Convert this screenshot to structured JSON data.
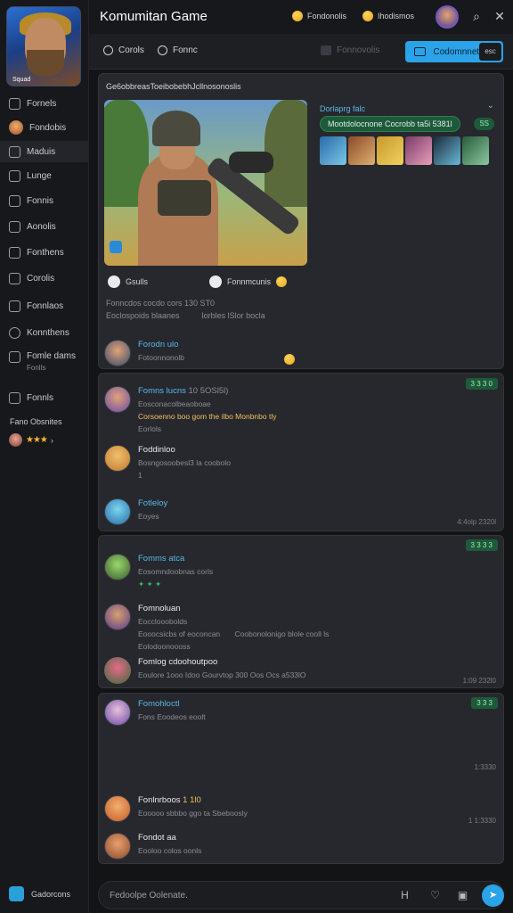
{
  "sidebar": {
    "logo_tag": "Squad",
    "items": [
      {
        "label": "Fornels",
        "icon": "chat-icon"
      },
      {
        "label": "Fondobis",
        "icon": "avatar-icon"
      },
      {
        "label": "Maduis",
        "icon": "gamepad-icon"
      },
      {
        "label": "Lunge",
        "icon": "bell-icon"
      },
      {
        "label": "Fonnis",
        "icon": "pencil-icon"
      },
      {
        "label": "Aonolis",
        "icon": "calendar-icon"
      },
      {
        "label": "Fonthens",
        "icon": "document-icon"
      },
      {
        "label": "Corolis",
        "icon": "document-icon"
      },
      {
        "label": "Fonnlaos",
        "icon": "folder-icon"
      },
      {
        "label": "Konnthens",
        "icon": "clock-icon"
      },
      {
        "label": "Fomle dams",
        "label2": "Fonlls",
        "icon": "list-icon"
      },
      {
        "label": "Fonnls",
        "icon": "users-icon"
      }
    ],
    "favorites_label": "Fano Obsnites",
    "favorites_stars": "★★★",
    "favorites_arrow": "›",
    "bottom_label": "Gadorcons"
  },
  "topbar": {
    "title": "Komumitan Game",
    "link1": "Fondonolis",
    "link2": "Ihodismos",
    "search_icon": "⌕",
    "close_icon": "✕"
  },
  "toolbar": {
    "item1": "Corols",
    "item2": "Fonnc",
    "ghost": "Fonnovolis",
    "cta_label": "Codomnnet",
    "cta_badge": "esc"
  },
  "post": {
    "header": "Ge6obbreasToeibobebhJcllnosonoslis",
    "media_title": "Dorlaprg falc",
    "media_pill": "Mootdolocnone Cocrobb ta5i 5381l",
    "media_count": "SS",
    "chev": "⌄",
    "chip1": "Gsulls",
    "chip2": "Fonnmcunis",
    "line1": "Fonncdos cocdo cors 130 ST0",
    "line2": "Eoclospoids blaanes",
    "line2b": "Iorbles lSlor bocla",
    "author_name": "Forodn ulo",
    "author_sub": "Fotoonnonolb"
  },
  "thread1": {
    "badge": "3 3 3 0",
    "m1_name": "Fomns lucns",
    "m1_meta": "10 5OSl5l)",
    "m1_sub": "Eosconacolbeaoboae",
    "m1_hl": "Corsoenno boo gom the ilbo Monbnbo tly",
    "m1_sub2": "Eorlols",
    "m2_name": "Foddinloo",
    "m2_sub": "Bosngosoobesl3 la coobolo",
    "m2_sub2": "1",
    "m3_name": "Fotleloy",
    "m3_sub": "Eoyes",
    "m3_time": "4:4olp 2320l"
  },
  "thread2": {
    "badge": "3 3 3 3",
    "m1_name": "Fomms atca",
    "m1_sub": "Eosomndoobnas corls",
    "m1_sub2": "✦ ✦ ✦",
    "m2_name": "Fomnoluan",
    "m2_sub": "Eocclooobolds",
    "m2_sub2": "Eooocsicbs of eoconcan",
    "m2_sub3": "Coobonolonigo blole cooll ls",
    "m2_sub4": "Eolodoonoooss",
    "m3_name": "Fomlog cdoohoutpoo",
    "m3_sub": "Eoulore 1ooo Idoo Gourvtop 300 Oos Ocs a533lO",
    "m3_time": "1:09 232l0"
  },
  "thread3": {
    "badge": "3 3 3",
    "m1_name": "Fomohloctl",
    "m1_sub": "Fons Eoodeos eoolt",
    "time1": "1:3330",
    "m2_name": "Fonlnrboos",
    "m2_meta": "1 1l0",
    "m2_sub": "Eooooo sbbbo ggo ta Sbeboosly",
    "time2": "1 1:3330",
    "m3_name": "Fondot aa",
    "m3_sub": "Eooloo colos oonls"
  },
  "composer": {
    "placeholder": "Fedoolpe Oolenate.",
    "icon1": "H",
    "icon2": "♡",
    "icon3": "▣",
    "send_icon": "➤"
  },
  "colors": {
    "accent": "#2aa3e8",
    "background": "#131416",
    "card": "#26282d",
    "badge_green": "#1e5a3a",
    "star": "#f5b82e"
  }
}
